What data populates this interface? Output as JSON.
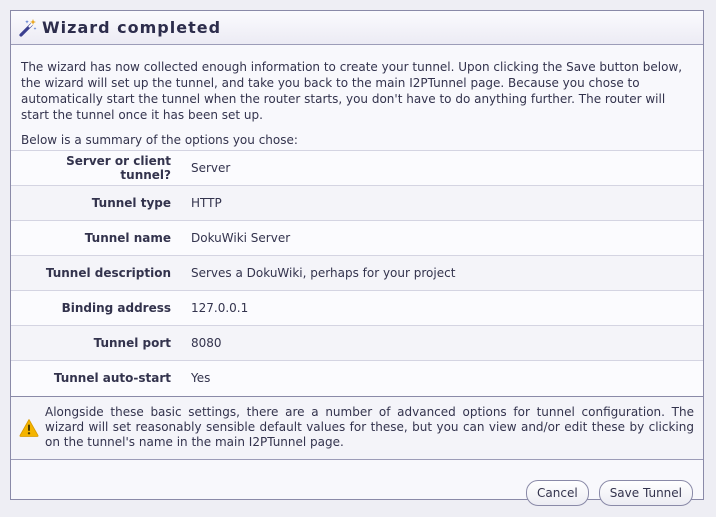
{
  "title": "Wizard completed",
  "intro": {
    "paragraph1": "The wizard has now collected enough information to create your tunnel. Upon clicking the Save button below, the wizard will set up the tunnel, and take you back to the main I2PTunnel page. Because you chose to automatically start the tunnel when the router starts, you don't have to do anything further. The router will start the tunnel once it has been set up.",
    "paragraph2": "Below is a summary of the options you chose:"
  },
  "summary": [
    {
      "label": "Server or client tunnel?",
      "value": "Server"
    },
    {
      "label": "Tunnel type",
      "value": "HTTP"
    },
    {
      "label": "Tunnel name",
      "value": "DokuWiki Server"
    },
    {
      "label": "Tunnel description",
      "value": "Serves a DokuWiki, perhaps for your project"
    },
    {
      "label": "Binding address",
      "value": "127.0.0.1"
    },
    {
      "label": "Tunnel port",
      "value": "8080"
    },
    {
      "label": "Tunnel auto-start",
      "value": "Yes"
    }
  ],
  "notice": {
    "icon": "warning-icon",
    "text": "Alongside these basic settings, there are a number of advanced options for tunnel configuration. The wizard will set reasonably sensible default values for these, but you can view and/or edit these by clicking on the tunnel's name in the main I2PTunnel page."
  },
  "buttons": {
    "cancel": "Cancel",
    "save": "Save Tunnel"
  },
  "colors": {
    "accent": "#2d2d4c",
    "background": "#eeeef4",
    "warning": "#f4b400"
  }
}
